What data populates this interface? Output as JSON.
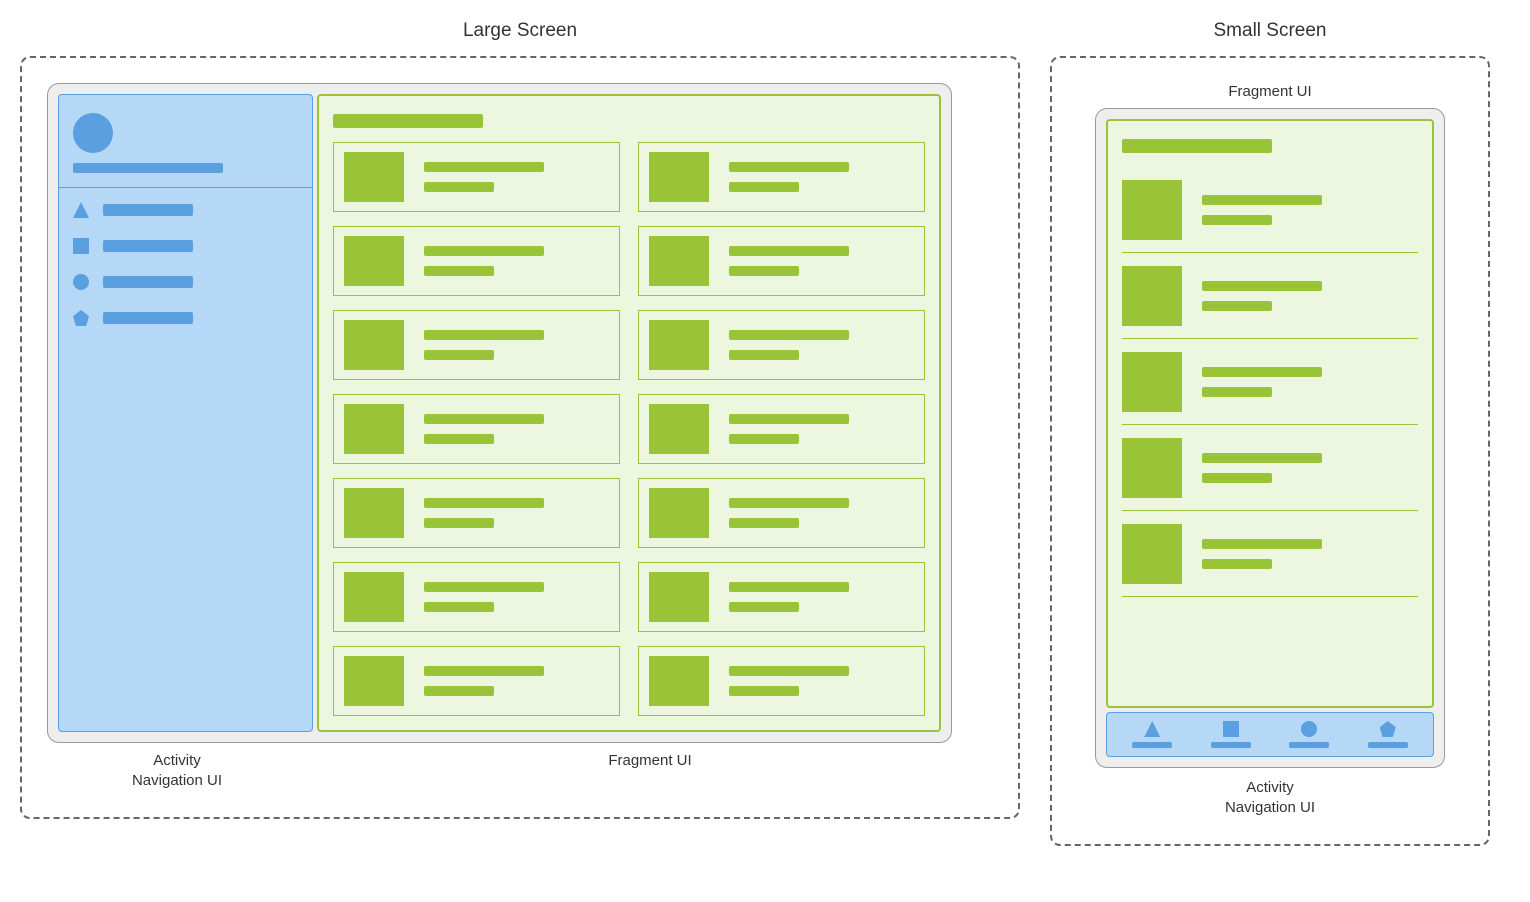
{
  "titles": {
    "large": "Large Screen",
    "small": "Small Screen"
  },
  "captions": {
    "activity_line1": "Activity",
    "activity_line2": "Navigation UI",
    "fragment": "Fragment UI"
  },
  "nav_icons": [
    {
      "shape": "triangle"
    },
    {
      "shape": "square"
    },
    {
      "shape": "circle"
    },
    {
      "shape": "pentagon"
    }
  ],
  "large_cards_count": 14,
  "small_cards_count": 5
}
